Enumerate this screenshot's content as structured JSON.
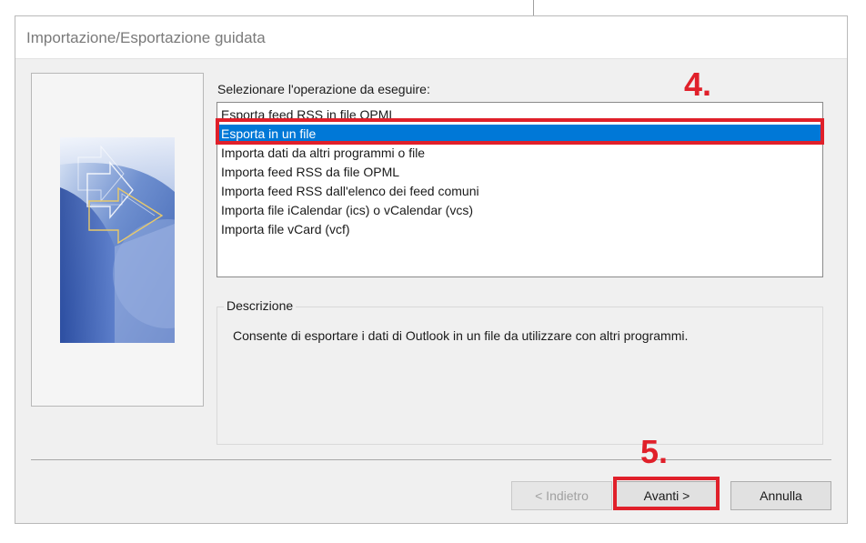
{
  "dialog": {
    "title": "Importazione/Esportazione guidata"
  },
  "prompt": "Selezionare l'operazione da eseguire:",
  "list": {
    "items": [
      "Esporta feed RSS in file OPML",
      "Esporta in un file",
      "Importa dati da altri programmi o file",
      "Importa feed RSS da file OPML",
      "Importa feed RSS dall'elenco dei feed comuni",
      "Importa file iCalendar (ics) o vCalendar (vcs)",
      "Importa file vCard (vcf)"
    ],
    "selected_index": 1
  },
  "description": {
    "legend": "Descrizione",
    "text": "Consente di esportare i dati di Outlook in un file da utilizzare con altri programmi."
  },
  "buttons": {
    "back": "< Indietro",
    "next": "Avanti >",
    "cancel": "Annulla"
  },
  "annotations": {
    "step4": "4.",
    "step5": "5.",
    "color": "#e0202a"
  },
  "colors": {
    "selection": "#0078d7"
  },
  "icons": {
    "wizard_art": "import-export-wizard-graphic"
  }
}
